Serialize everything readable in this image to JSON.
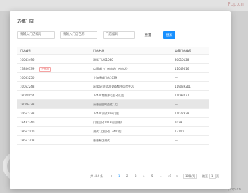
{
  "background": {
    "top_text": "Pbp.cn",
    "footer_text": "php.cn"
  },
  "dialog": {
    "title": "选择门店",
    "filters": {
      "store_code_placeholder": "请输入门店编号",
      "store_name_placeholder": "请输入门店名称",
      "third_placeholder": "门店编码",
      "reset_label": "重置",
      "search_label": "搜索"
    },
    "table": {
      "columns": [
        "门店编号",
        "门店名称",
        "商家门店编号"
      ],
      "rows": [
        {
          "code": "10043496",
          "tag": "",
          "name": "测试门店01080",
          "merchant": "30010128"
        },
        {
          "code": "17856339",
          "tag": "已停用",
          "name": "店通城（广州南站广州市店）",
          "merchant": "11049516"
        },
        {
          "code": "10053250",
          "tag": "",
          "name": "上海杨浦门店1039",
          "merchant": "—"
        },
        {
          "code": "10052248",
          "tag": "",
          "name": "xinbay测试00196都市体验手01",
          "merchant": "1190392b1"
        },
        {
          "code": "18078054",
          "tag": "",
          "name": "T7440期限中心自动门店",
          "merchant": "11093477"
        },
        {
          "code": "18076328",
          "tag": "",
          "name": "清香园里的西红门店",
          "merchant": "—"
        },
        {
          "code": "10652328",
          "tag": "",
          "name": "T7440测试8aix门店",
          "merchant": "11022328"
        },
        {
          "code": "18482240",
          "tag": "",
          "name": "门店自动1018项目测试",
          "merchant": "1029"
        },
        {
          "code": "18662100",
          "tag": "",
          "name": "测试门店自动T7440店",
          "merchant": "T7140"
        },
        {
          "code": "18657308",
          "tag": "",
          "name": "香香有店测试",
          "merchant": "—"
        }
      ],
      "highlighted_row": 5
    },
    "pagination": {
      "total": "共 484 条",
      "prev": "<",
      "pages": [
        "1",
        "2",
        "3",
        "4",
        "5",
        "...",
        "49"
      ],
      "next": ">",
      "page_size": "10条/页",
      "jump_label": "跳至",
      "jump_value": "1",
      "page_suffix": "页"
    }
  }
}
